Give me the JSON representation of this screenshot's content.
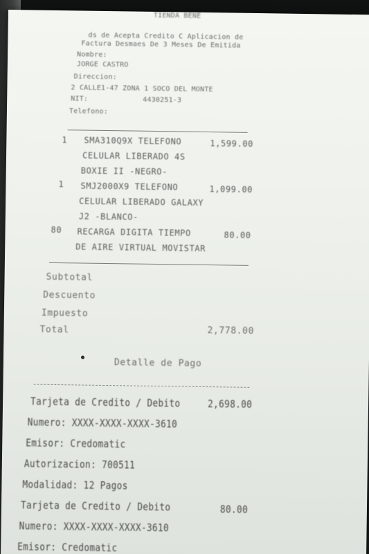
{
  "header": {
    "store_name": "TIENDA BENE",
    "line1": "ds de Acepta Credito C Aplicacion de",
    "line2": "Factura Desmaes De 3 Meses De Emitida",
    "nombre_label": "Nombre:",
    "nombre_value": "JORGE CASTRO",
    "direccion_label": "Direccion:",
    "direccion_value": "2 CALLE1-47 ZONA 1 SOCO DEL MONTE",
    "nit_label": "NIT:",
    "nit_value": "4430251-3",
    "telefono_label": "Telefono:"
  },
  "items": [
    {
      "qty": "1",
      "lines": [
        "SMA310Q9X TELEFONO",
        "CELULAR LIBERADO 4S",
        "BOXIE II -NEGRO-"
      ],
      "amount": "1,599.00"
    },
    {
      "qty": "1",
      "lines": [
        "SMJ2000X9 TELEFONO",
        "CELULAR LIBERADO GALAXY",
        "J2 -BLANCO-"
      ],
      "amount": "1,099.00"
    },
    {
      "qty": "80",
      "lines": [
        "RECARGA DIGITA TIEMPO",
        "DE AIRE VIRTUAL MOVISTAR"
      ],
      "amount": "80.00"
    }
  ],
  "summary": {
    "subtotal_label": "Subtotal",
    "descuento_label": "Descuento",
    "impuesto_label": "Impuesto",
    "total_label": "Total",
    "total_value": "2,778.00"
  },
  "payment": {
    "detail_title": "Detalle de Pago",
    "entries": [
      {
        "method": "Tarjeta de Credito / Debito",
        "amount": "2,698.00",
        "numero": "Numero: XXXX-XXXX-XXXX-3610",
        "emisor": "Emisor: Credomatic",
        "autorizacion": "Autorizacion: 700511",
        "modalidad": "Modalidad: 12 Pagos"
      },
      {
        "method": "Tarjeta de Credito / Debito",
        "amount": "80.00",
        "numero": "Numero: XXXX-XXXX-XXXX-3610",
        "emisor": "Emisor: Credomatic"
      }
    ]
  }
}
